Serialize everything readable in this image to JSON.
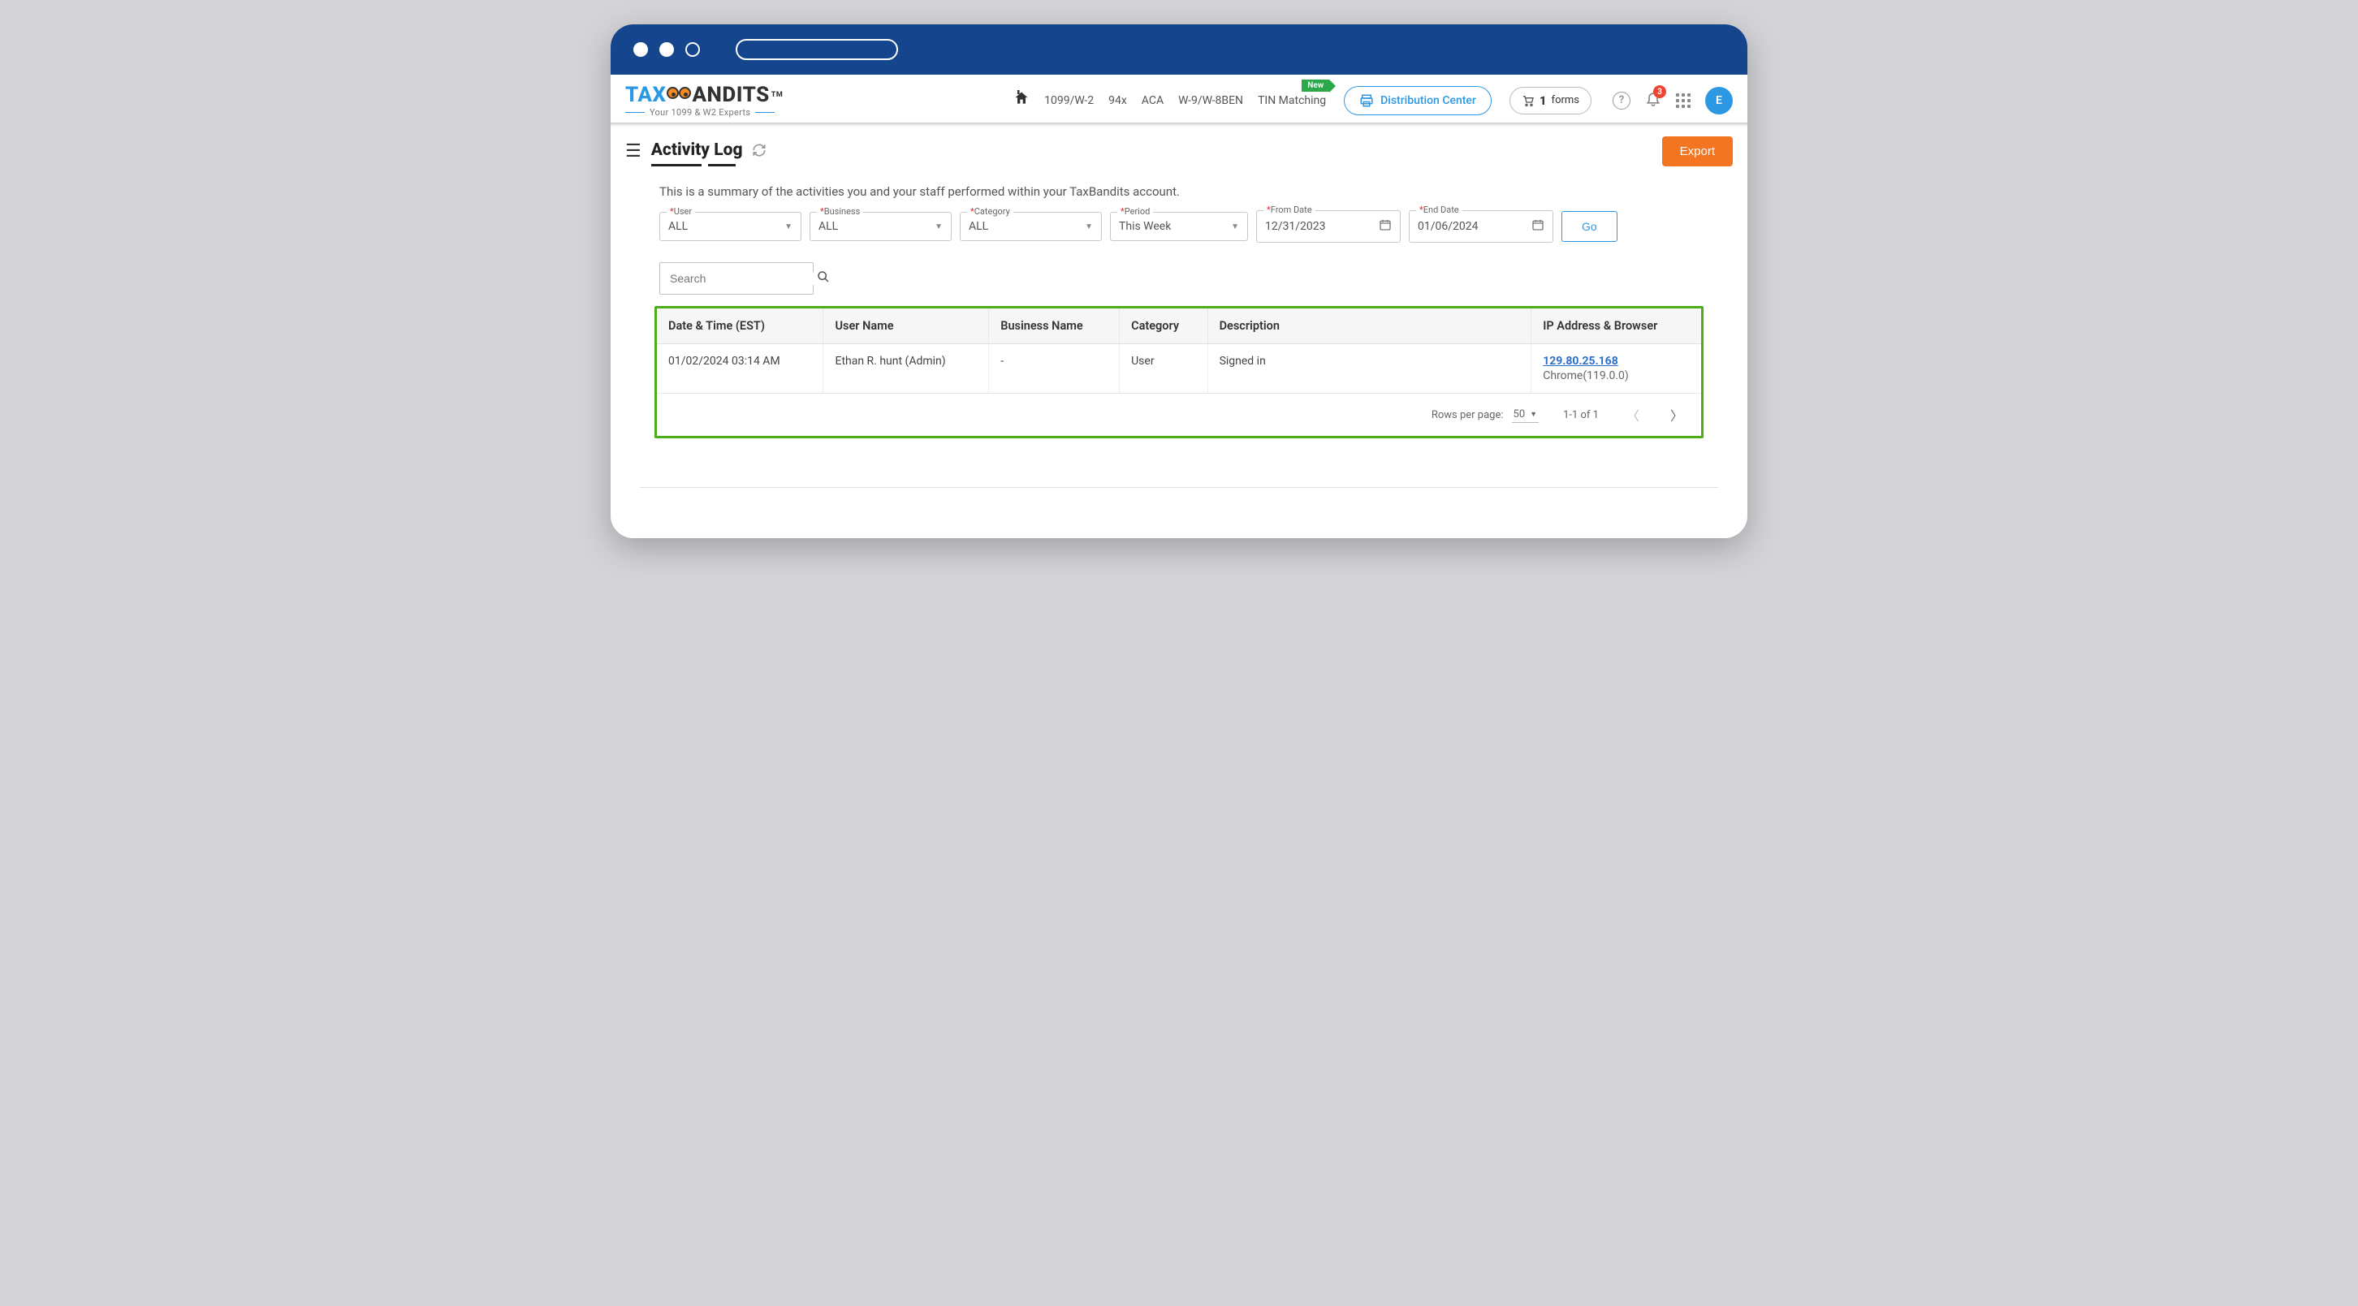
{
  "logo": {
    "prefix": "TAX",
    "suffix": "ANDITS",
    "tm": "TM",
    "tagline": "Your 1099 & W2 Experts"
  },
  "nav": {
    "items": [
      "1099/W-2",
      "94x",
      "ACA",
      "W-9/W-8BEN",
      "TIN Matching"
    ],
    "new_badge": "New",
    "distribution": "Distribution Center",
    "forms_count": "1",
    "forms_label": "forms",
    "notif_count": "3",
    "avatar_initial": "E"
  },
  "page": {
    "title": "Activity Log",
    "description": "This is a summary of the activities you and your staff performed within your TaxBandits account.",
    "export_label": "Export"
  },
  "filters": {
    "user": {
      "label": "User",
      "value": "ALL"
    },
    "business": {
      "label": "Business",
      "value": "ALL"
    },
    "category": {
      "label": "Category",
      "value": "ALL"
    },
    "period": {
      "label": "Period",
      "value": "This Week"
    },
    "from": {
      "label": "From Date",
      "value": "12/31/2023"
    },
    "end": {
      "label": "End Date",
      "value": "01/06/2024"
    },
    "go": "Go",
    "search_placeholder": "Search"
  },
  "table": {
    "headers": [
      "Date & Time (EST)",
      "User Name",
      "Business Name",
      "Category",
      "Description",
      "IP Address & Browser"
    ],
    "rows": [
      {
        "datetime": "01/02/2024 03:14 AM",
        "user": "Ethan R. hunt (Admin)",
        "business": "-",
        "category": "User",
        "description": "Signed in",
        "ip": "129.80.25.168",
        "browser": "Chrome(119.0.0)"
      }
    ],
    "footer": {
      "rows_per_page_label": "Rows per page:",
      "rows_per_page_value": "50",
      "range": "1-1 of 1"
    }
  }
}
